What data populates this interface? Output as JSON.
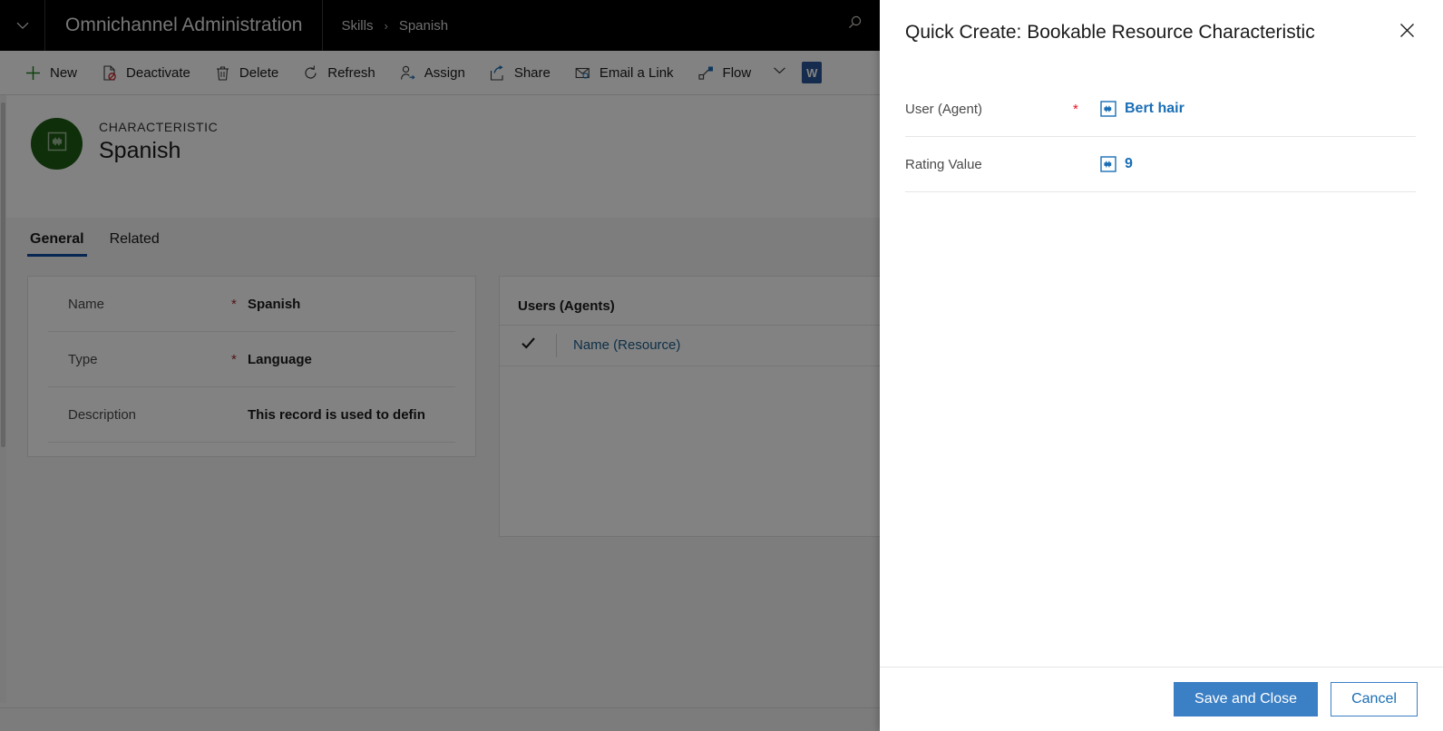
{
  "topbar": {
    "app_title": "Omnichannel Administration",
    "chevron_icon": "chevron-down-icon",
    "search_icon": "search-icon",
    "breadcrumb": [
      {
        "label": "Skills"
      },
      {
        "label": "Spanish"
      }
    ],
    "breadcrumb_separator": "›"
  },
  "commandbar": {
    "commands": [
      {
        "label": "New",
        "icon": "plus-icon"
      },
      {
        "label": "Deactivate",
        "icon": "deactivate-document-icon"
      },
      {
        "label": "Delete",
        "icon": "trash-icon"
      },
      {
        "label": "Refresh",
        "icon": "refresh-icon"
      },
      {
        "label": "Assign",
        "icon": "assign-person-icon"
      },
      {
        "label": "Share",
        "icon": "share-icon"
      },
      {
        "label": "Email a Link",
        "icon": "email-link-icon"
      },
      {
        "label": "Flow",
        "icon": "flow-icon"
      }
    ],
    "overflow_icon": "chevron-down-icon",
    "word_icon_label": "W"
  },
  "record": {
    "entity_type": "CHARACTERISTIC",
    "name": "Spanish",
    "avatar_icon": "characteristic-entity-icon",
    "avatar_color": "#1d5c12"
  },
  "tabs": [
    {
      "label": "General",
      "active": true
    },
    {
      "label": "Related",
      "active": false
    }
  ],
  "form": {
    "fields": [
      {
        "label": "Name",
        "required": "*",
        "value": "Spanish"
      },
      {
        "label": "Type",
        "required": "*",
        "value": "Language"
      },
      {
        "label": "Description",
        "required": "",
        "value": "This record is used to defin"
      }
    ]
  },
  "subgrid": {
    "title": "Users (Agents)",
    "select_all_icon": "checkmark-icon",
    "columns": [
      {
        "label": "Name (Resource)"
      }
    ]
  },
  "quick_create": {
    "title": "Quick Create: Bookable Resource Characteristic",
    "close_icon": "close-icon",
    "fields": [
      {
        "label": "User (Agent)",
        "required": "*",
        "value": "Bert hair",
        "icon": "bookable-resource-entity-icon"
      },
      {
        "label": "Rating Value",
        "required": "",
        "value": "9",
        "icon": "bookable-resource-entity-icon"
      }
    ],
    "save_label": "Save and Close",
    "cancel_label": "Cancel",
    "primary_color": "#3b7fc4",
    "link_color": "#1a6eb5"
  }
}
